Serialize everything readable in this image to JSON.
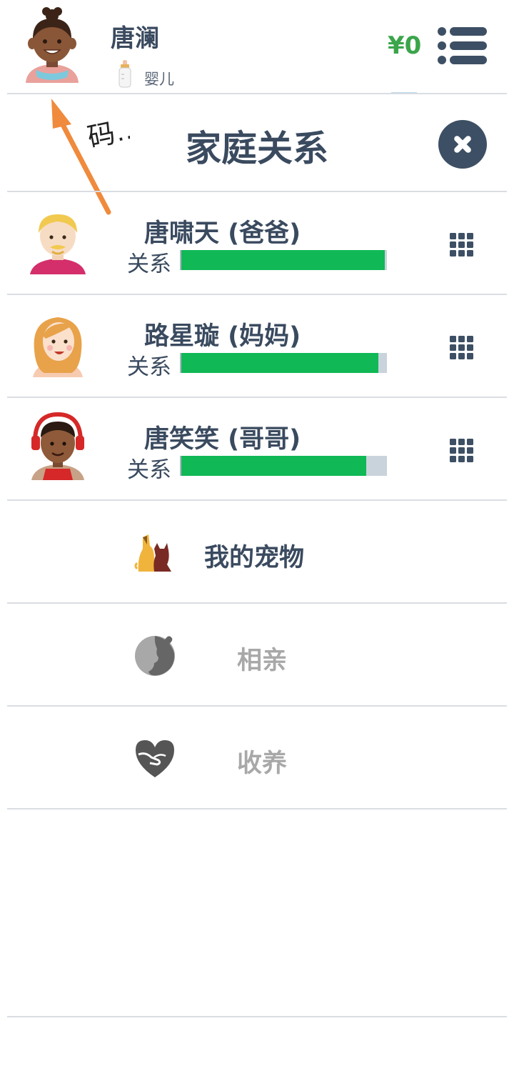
{
  "header": {
    "player_name": "唐澜",
    "life_stage": "婴儿",
    "money": "¥0"
  },
  "panel": {
    "title": "家庭关系"
  },
  "hint": {
    "text": "码…"
  },
  "relatives": [
    {
      "name": "唐啸天 (爸爸)",
      "relation_label": "关系",
      "relation_value": 0.99,
      "avatar": "blond-man-avatar"
    },
    {
      "name": "路星璇 (妈妈)",
      "relation_label": "关系",
      "relation_value": 0.96,
      "avatar": "red-hair-woman-avatar"
    },
    {
      "name": "唐笑笑 (哥哥)",
      "relation_label": "关系",
      "relation_value": 0.9,
      "avatar": "headphones-boy-avatar"
    }
  ],
  "actions": [
    {
      "label": "我的宠物",
      "icon": "pet-icon",
      "enabled": true
    },
    {
      "label": "相亲",
      "icon": "dating-icon",
      "enabled": false
    },
    {
      "label": "收养",
      "icon": "adoption-heart-icon",
      "enabled": false
    }
  ],
  "colors": {
    "text_dark": "#3a4a5f",
    "money_green": "#3aa54a",
    "bar_green": "#10b856",
    "bar_empty": "#c9d3dc",
    "disabled_text": "#a8a8a8",
    "arrow_orange": "#f08a3c"
  }
}
